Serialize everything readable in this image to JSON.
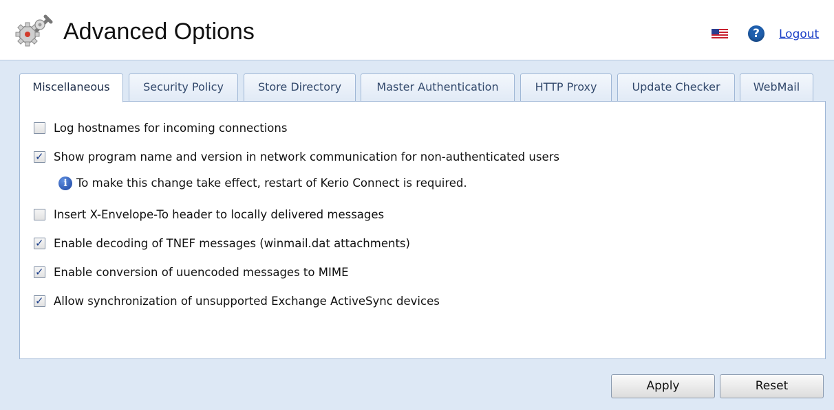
{
  "header": {
    "title": "Advanced Options",
    "logout_label": "Logout",
    "help_glyph": "?",
    "icons": {
      "app": "gears-icon",
      "language": "us-flag-icon",
      "help": "help-icon"
    }
  },
  "tabs": [
    {
      "label": "Miscellaneous",
      "active": true
    },
    {
      "label": "Security Policy",
      "active": false
    },
    {
      "label": "Store Directory",
      "active": false
    },
    {
      "label": "Master Authentication",
      "active": false
    },
    {
      "label": "HTTP Proxy",
      "active": false
    },
    {
      "label": "Update Checker",
      "active": false
    },
    {
      "label": "WebMail",
      "active": false
    }
  ],
  "options": [
    {
      "label": "Log hostnames for incoming connections",
      "checked": false
    },
    {
      "label": "Show program name and version in network communication for non-authenticated users",
      "checked": true
    },
    {
      "label": "Insert X-Envelope-To header to locally delivered messages",
      "checked": false
    },
    {
      "label": "Enable decoding of TNEF messages (winmail.dat attachments)",
      "checked": true
    },
    {
      "label": "Enable conversion of uuencoded messages to MIME",
      "checked": true
    },
    {
      "label": "Allow synchronization of unsupported Exchange ActiveSync devices",
      "checked": true
    }
  ],
  "note": {
    "text": "To make this change take effect, restart of Kerio Connect is required.",
    "icon_glyph": "i"
  },
  "buttons": {
    "apply": "Apply",
    "reset": "Reset"
  },
  "colors": {
    "background": "#dde8f5",
    "border": "#9fb7d6",
    "link": "#1a3fc7"
  }
}
